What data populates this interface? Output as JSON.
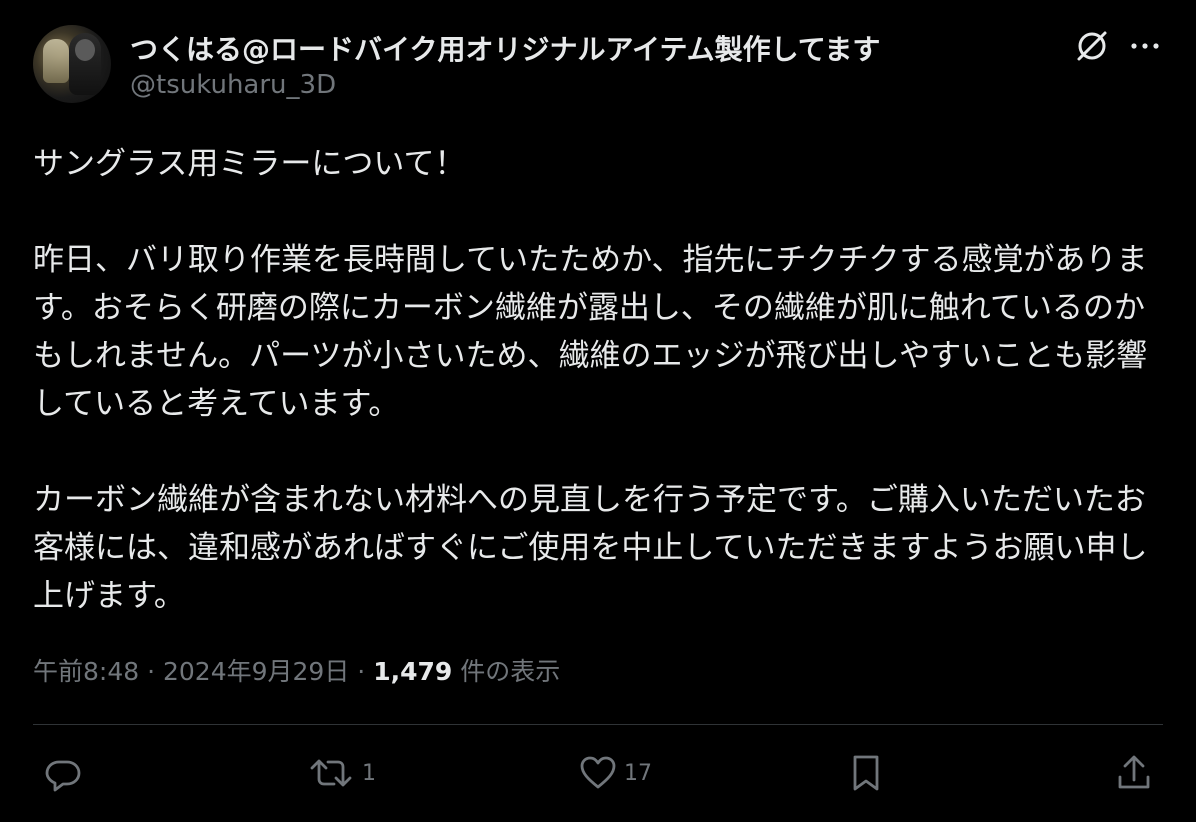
{
  "author": {
    "display_name": "つくはる@ロードバイク用オリジナルアイテム製作してます",
    "handle": "@tsukuharu_3D"
  },
  "tweet": {
    "paragraphs": [
      "サングラス用ミラーについて！",
      "昨日、バリ取り作業を長時間していたためか、指先にチクチクする感覚があります。おそらく研磨の際にカーボン繊維が露出し、その繊維が肌に触れているのかもしれません。パーツが小さいため、繊維のエッジが飛び出しやすいことも影響していると考えています。",
      "カーボン繊維が含まれない材料への見直しを行う予定です。ご購入いただいたお客様には、違和感があればすぐにご使用を中止していただきますようお願い申し上げます。"
    ]
  },
  "meta": {
    "time": "午前8:48",
    "separator": "·",
    "date": "2024年9月29日",
    "views_count": "1,479",
    "views_label": "件の表示"
  },
  "actions": {
    "reply_count": "",
    "retweet_count": "1",
    "like_count": "17"
  },
  "icons": {
    "top_right": [
      "grok-icon",
      "more-icon"
    ],
    "action_bar": [
      "reply-icon",
      "retweet-icon",
      "like-icon",
      "bookmark-icon",
      "share-icon"
    ]
  },
  "colors": {
    "background": "#000000",
    "text_primary": "#e7e9ea",
    "text_secondary": "#71767b",
    "divider": "#2f3336"
  }
}
